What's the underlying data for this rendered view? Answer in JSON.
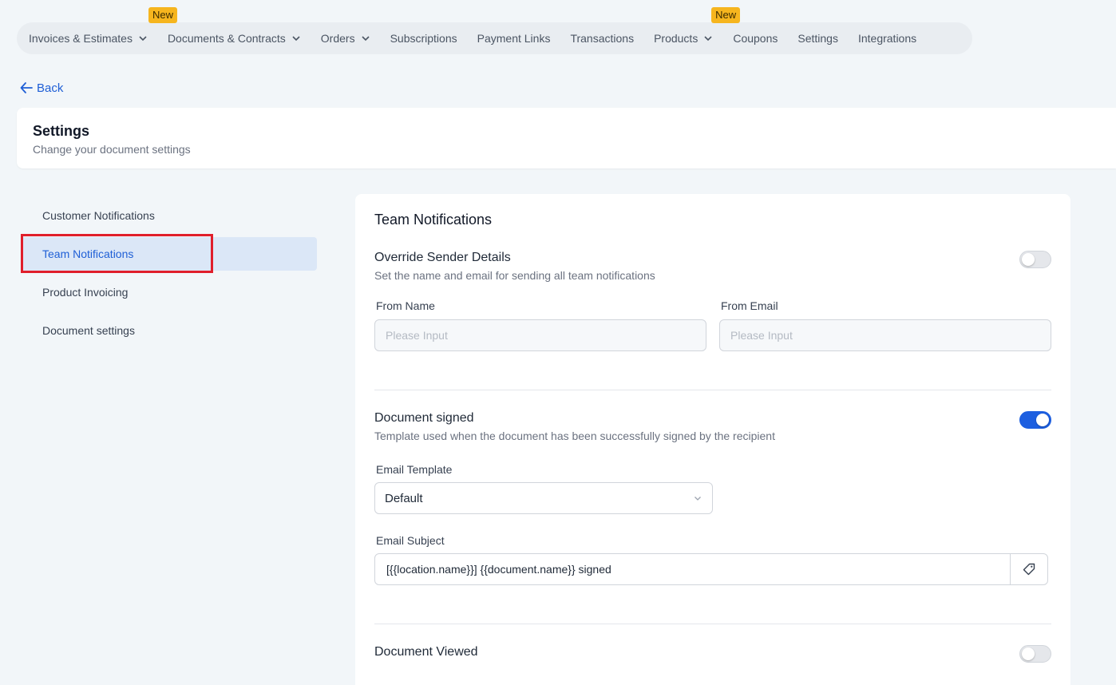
{
  "topnav": {
    "items": [
      {
        "label": "Invoices & Estimates",
        "dropdown": true,
        "badge": ""
      },
      {
        "label": "Documents & Contracts",
        "dropdown": true,
        "badge": ""
      },
      {
        "label": "Orders",
        "dropdown": true,
        "badge": ""
      },
      {
        "label": "Subscriptions",
        "dropdown": false,
        "badge": ""
      },
      {
        "label": "Payment Links",
        "dropdown": false,
        "badge": ""
      },
      {
        "label": "Transactions",
        "dropdown": false,
        "badge": ""
      },
      {
        "label": "Products",
        "dropdown": true,
        "badge": ""
      },
      {
        "label": "Coupons",
        "dropdown": false,
        "badge": ""
      },
      {
        "label": "Settings",
        "dropdown": false,
        "badge": ""
      },
      {
        "label": "Integrations",
        "dropdown": false,
        "badge": ""
      }
    ],
    "badge_label": "New"
  },
  "back_label": "Back",
  "header": {
    "title": "Settings",
    "subtitle": "Change your document settings"
  },
  "sidebar": {
    "items": [
      {
        "label": "Customer Notifications"
      },
      {
        "label": "Team Notifications"
      },
      {
        "label": "Product Invoicing"
      },
      {
        "label": "Document settings"
      }
    ],
    "active_index": 1
  },
  "main": {
    "title": "Team Notifications",
    "override": {
      "title": "Override Sender Details",
      "description": "Set the name and email for sending all team notifications",
      "enabled": false,
      "from_name_label": "From Name",
      "from_name_placeholder": "Please Input",
      "from_email_label": "From Email",
      "from_email_placeholder": "Please Input"
    },
    "signed": {
      "title": "Document signed",
      "description": "Template used when the document has been successfully signed by the recipient",
      "enabled": true,
      "template_label": "Email Template",
      "template_value": "Default",
      "subject_label": "Email Subject",
      "subject_value": "[{{location.name}}] {{document.name}} signed"
    },
    "viewed": {
      "title": "Document Viewed",
      "enabled": false
    }
  },
  "colors": {
    "accent": "#1d5fe0",
    "badge": "#f6b51e",
    "highlight": "#e01e2b"
  }
}
